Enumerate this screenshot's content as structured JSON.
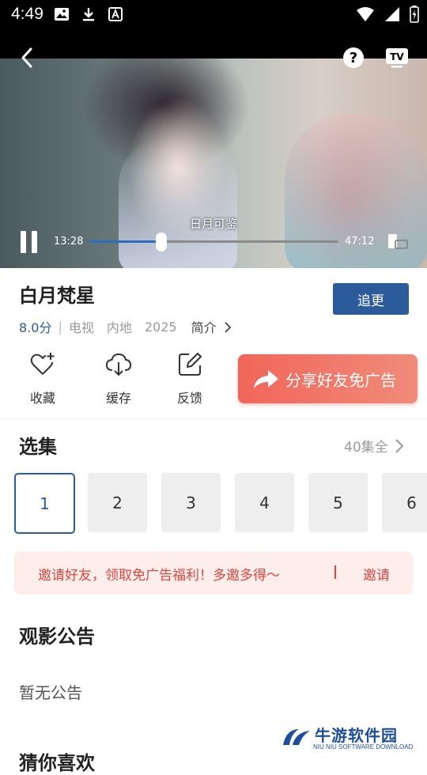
{
  "status_bar": {
    "time": "4:49"
  },
  "player": {
    "subtitle": "日月可鉴",
    "current_time": "13:28",
    "total_time": "47:12",
    "progress": 0.29
  },
  "show": {
    "title": "白月梵星",
    "follow_label": "追更",
    "score": "8.0分",
    "separator": "|",
    "category": "电视",
    "region": "内地",
    "year": "2025",
    "intro_label": "简介"
  },
  "actions": [
    {
      "label": "收藏",
      "icon": "heart-plus-icon"
    },
    {
      "label": "缓存",
      "icon": "cloud-download-icon"
    },
    {
      "label": "反馈",
      "icon": "edit-icon"
    }
  ],
  "share_banner": {
    "label": "分享好友免广告"
  },
  "episodes": {
    "title": "选集",
    "total_label": "40集全",
    "items": [
      "1",
      "2",
      "3",
      "4",
      "5",
      "6"
    ],
    "selected": "1"
  },
  "invite": {
    "text": "邀请好友，领取免广告福利！多邀多得～",
    "button": "邀请"
  },
  "notice": {
    "title": "观影公告",
    "body": "暂无公告"
  },
  "guess": {
    "title": "猜你喜欢"
  },
  "watermark": {
    "name": "牛游软件园",
    "sub": "NIU NIU SOFTWARE DOWNLOAD"
  },
  "colors": {
    "accent": "#2b5b9a",
    "invite_red": "#e0463c"
  }
}
